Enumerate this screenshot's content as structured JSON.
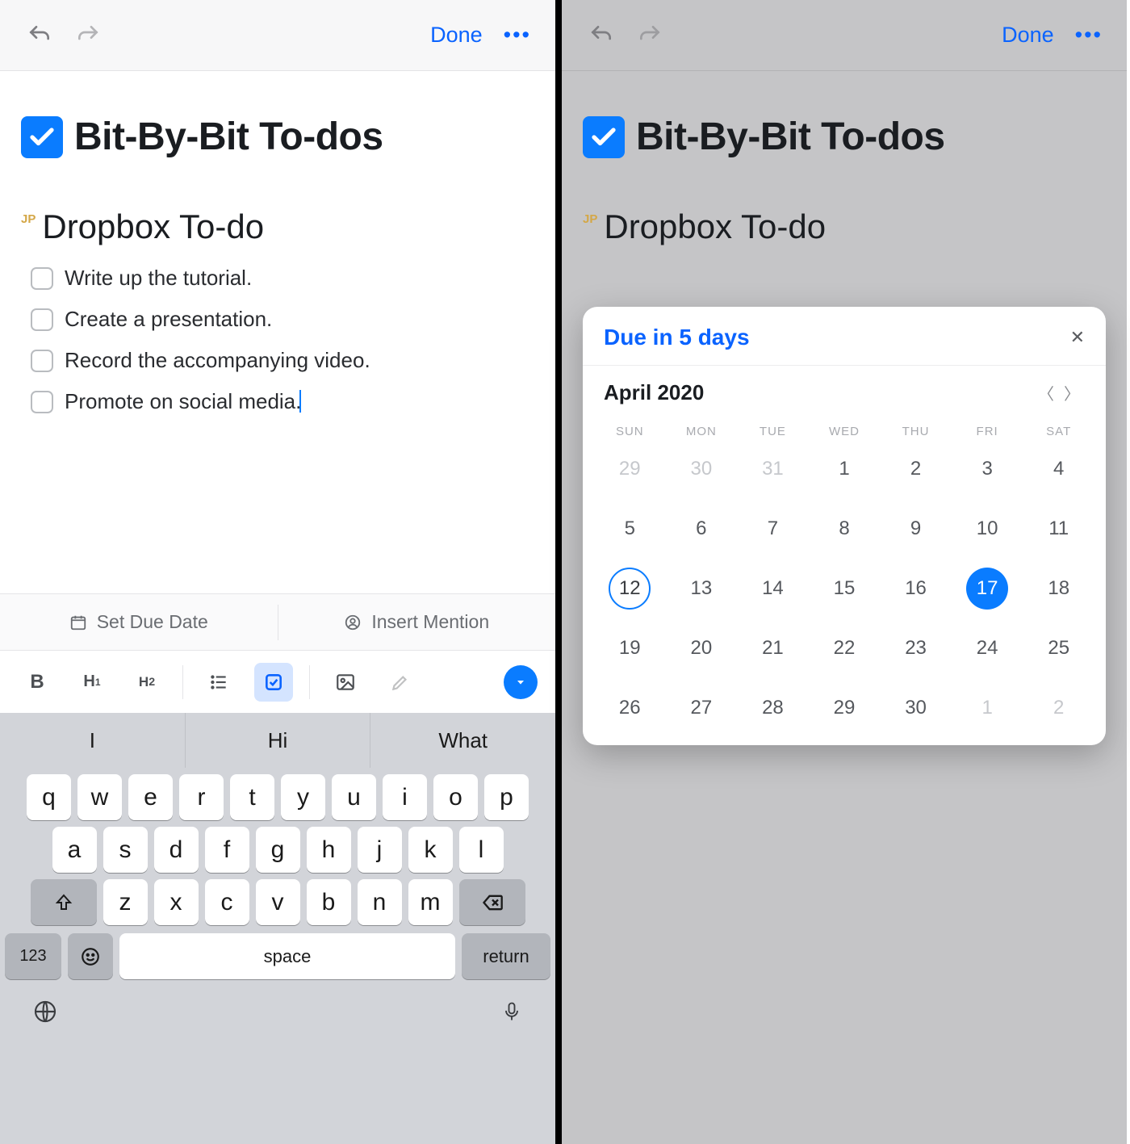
{
  "nav": {
    "done": "Done",
    "more": "•••"
  },
  "doc": {
    "title": "Bit-By-Bit To-dos",
    "author_initials": "JP",
    "subtitle": "Dropbox To-do",
    "todos": [
      "Write up the tutorial.",
      "Create a presentation.",
      "Record the accompanying video.",
      "Promote on social media."
    ]
  },
  "actions": {
    "due_date": "Set Due Date",
    "mention": "Insert Mention"
  },
  "fmt": {
    "bold": "B",
    "h1": "H",
    "h1s": "1",
    "h2": "H",
    "h2s": "2"
  },
  "keyboard": {
    "predictions": [
      "I",
      "Hi",
      "What"
    ],
    "row1": [
      "q",
      "w",
      "e",
      "r",
      "t",
      "y",
      "u",
      "i",
      "o",
      "p"
    ],
    "row2": [
      "a",
      "s",
      "d",
      "f",
      "g",
      "h",
      "j",
      "k",
      "l"
    ],
    "row3": [
      "z",
      "x",
      "c",
      "v",
      "b",
      "n",
      "m"
    ],
    "num": "123",
    "space": "space",
    "return": "return"
  },
  "cal": {
    "popover_title": "Due in 5 days",
    "month": "April 2020",
    "dow": [
      "SUN",
      "MON",
      "TUE",
      "WED",
      "THU",
      "FRI",
      "SAT"
    ],
    "days": [
      {
        "n": "29",
        "o": true
      },
      {
        "n": "30",
        "o": true
      },
      {
        "n": "31",
        "o": true
      },
      {
        "n": "1"
      },
      {
        "n": "2"
      },
      {
        "n": "3"
      },
      {
        "n": "4"
      },
      {
        "n": "5"
      },
      {
        "n": "6"
      },
      {
        "n": "7"
      },
      {
        "n": "8"
      },
      {
        "n": "9"
      },
      {
        "n": "10"
      },
      {
        "n": "11"
      },
      {
        "n": "12",
        "today": true
      },
      {
        "n": "13"
      },
      {
        "n": "14"
      },
      {
        "n": "15"
      },
      {
        "n": "16"
      },
      {
        "n": "17",
        "sel": true
      },
      {
        "n": "18"
      },
      {
        "n": "19"
      },
      {
        "n": "20"
      },
      {
        "n": "21"
      },
      {
        "n": "22"
      },
      {
        "n": "23"
      },
      {
        "n": "24"
      },
      {
        "n": "25"
      },
      {
        "n": "26"
      },
      {
        "n": "27"
      },
      {
        "n": "28"
      },
      {
        "n": "29"
      },
      {
        "n": "30"
      },
      {
        "n": "1",
        "o": true
      },
      {
        "n": "2",
        "o": true
      }
    ]
  }
}
